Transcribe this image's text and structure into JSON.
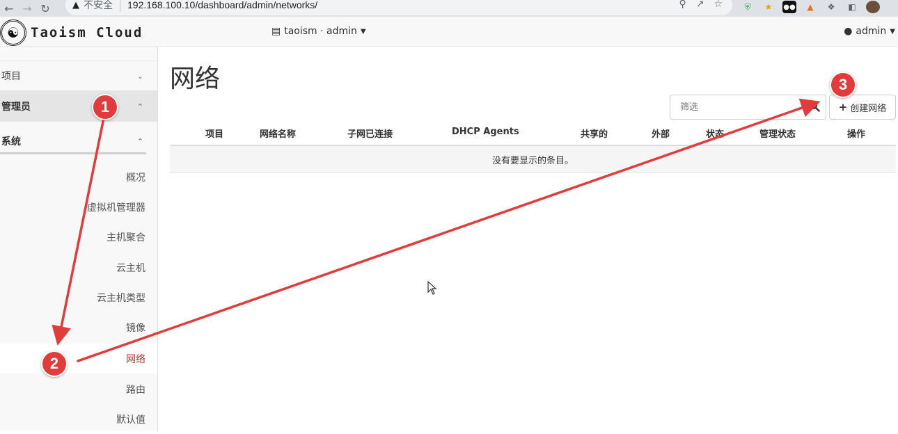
{
  "browser": {
    "security_label": "不安全",
    "url": "192.168.100.10/dashboard/admin/networks/"
  },
  "header": {
    "brand": "Taoism Cloud",
    "project_switcher": "taoism · admin",
    "user": "admin"
  },
  "sidebar": {
    "panels": {
      "project": "项目",
      "admin": "管理员",
      "system": "系统"
    },
    "items": [
      {
        "label": "概况"
      },
      {
        "label": "虚拟机管理器"
      },
      {
        "label": "主机聚合"
      },
      {
        "label": "云主机"
      },
      {
        "label": "云主机类型"
      },
      {
        "label": "镜像"
      },
      {
        "label": "网络"
      },
      {
        "label": "路由"
      },
      {
        "label": "默认值"
      }
    ],
    "active_item": "网络"
  },
  "main": {
    "title": "网络",
    "filter_placeholder": "筛选",
    "create_button": "创建网络",
    "table": {
      "columns": [
        "项目",
        "网络名称",
        "子网已连接",
        "DHCP Agents",
        "共享的",
        "外部",
        "状态",
        "管理状态",
        "操作"
      ],
      "empty_message": "没有要显示的条目。"
    }
  },
  "annotations": {
    "markers": [
      "1",
      "2",
      "3"
    ],
    "color": "#e23b3b"
  }
}
